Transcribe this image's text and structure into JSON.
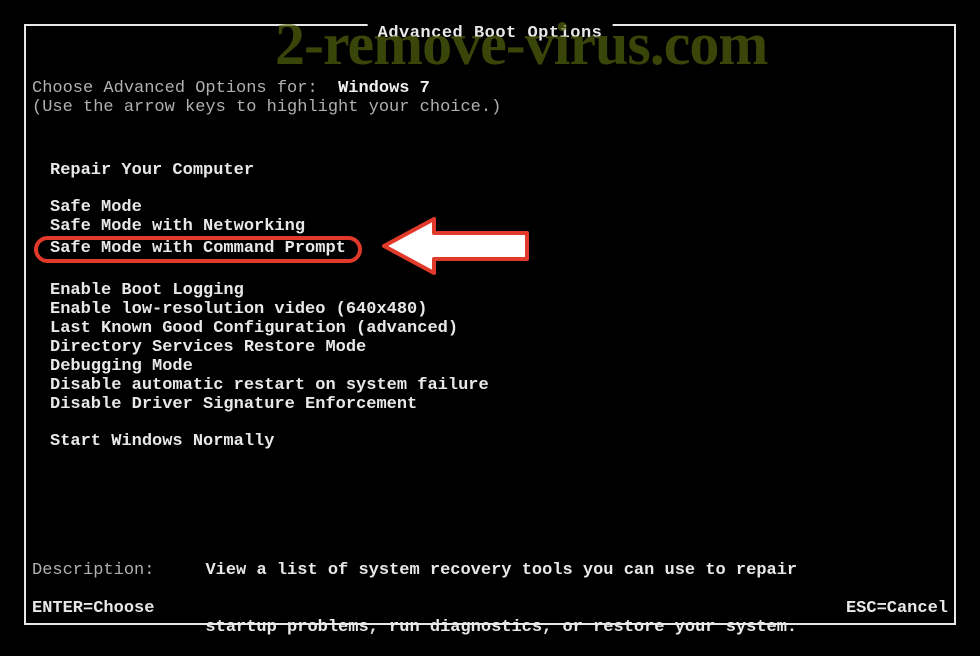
{
  "title": "Advanced Boot Options",
  "choose_label": "Choose Advanced Options for:  ",
  "os_name": "Windows 7",
  "instruction": "(Use the arrow keys to highlight your choice.)",
  "groups": [
    {
      "items": [
        "Repair Your Computer"
      ]
    },
    {
      "items": [
        "Safe Mode",
        "Safe Mode with Networking",
        "Safe Mode with Command Prompt"
      ]
    },
    {
      "items": [
        "Enable Boot Logging",
        "Enable low-resolution video (640x480)",
        "Last Known Good Configuration (advanced)",
        "Directory Services Restore Mode",
        "Debugging Mode",
        "Disable automatic restart on system failure",
        "Disable Driver Signature Enforcement"
      ]
    },
    {
      "items": [
        "Start Windows Normally"
      ]
    }
  ],
  "highlighted_index": "1.2",
  "description_label": "Description:     ",
  "description_text_l1": "View a list of system recovery tools you can use to repair",
  "description_text_l2": "                 startup problems, run diagnostics, or restore your system.",
  "footer_enter": "ENTER=Choose",
  "footer_esc": "ESC=Cancel",
  "watermark": "2-remove-virus.com"
}
